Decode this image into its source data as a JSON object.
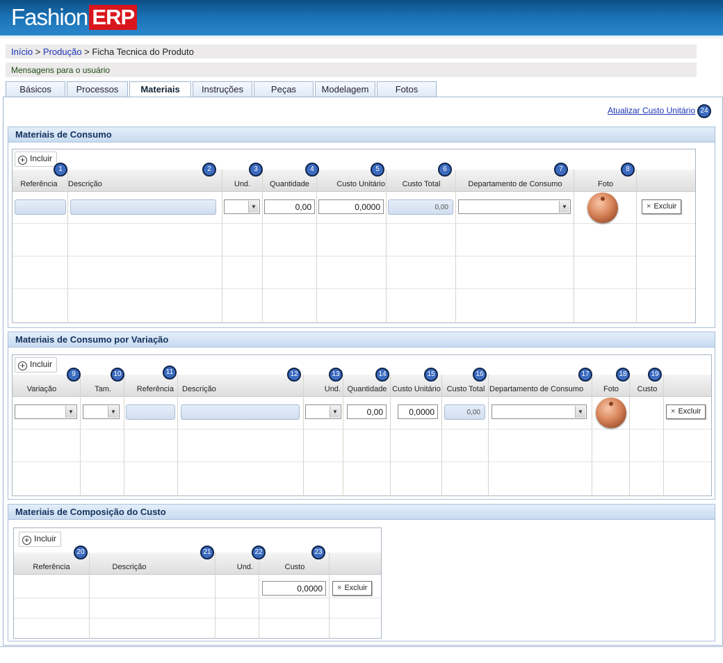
{
  "logo": {
    "part1": "Fashion",
    "part2": "ERP"
  },
  "breadcrumb": {
    "home": "Início",
    "sep1": ">",
    "area": "Produção",
    "sep2": ">",
    "page": "Ficha Tecnica do Produto"
  },
  "messages": "Mensagens para o usuário",
  "tabs": [
    "Básicos",
    "Processos",
    "Materiais",
    "Instruções",
    "Peças",
    "Modelagem",
    "Fotos"
  ],
  "active_tab": "Materiais",
  "update_link": "Atualizar Custo Unitário",
  "update_badge": "24",
  "include_label": "Incluir",
  "delete_label": "Excluir",
  "section1": {
    "title": "Materiais de Consumo",
    "columns": [
      "Referência",
      "Descrição",
      "Und.",
      "Quantidade",
      "Custo Unitário",
      "Custo Total",
      "Departamento de Consumo",
      "Foto"
    ],
    "badges": [
      "1",
      "2",
      "3",
      "4",
      "5",
      "6",
      "7",
      "8"
    ],
    "row": {
      "quantidade": "0,00",
      "custo_unitario": "0,0000",
      "custo_total": "0,00"
    }
  },
  "section2": {
    "title": "Materiais de Consumo por Variação",
    "columns": [
      "Variação",
      "Tam.",
      "Referência",
      "Descrição",
      "Und.",
      "Quantidade",
      "Custo Unitário",
      "Custo Total",
      "Departamento de Consumo",
      "Foto",
      "Custo"
    ],
    "badges": [
      "9",
      "10",
      "11",
      "12",
      "13",
      "14",
      "15",
      "16",
      "17",
      "18",
      "19"
    ],
    "row": {
      "quantidade": "0,00",
      "custo_unitario": "0,0000",
      "custo_total": "0,00"
    }
  },
  "section3": {
    "title": "Materiais de Composição do Custo",
    "columns": [
      "Referência",
      "Descrição",
      "Und.",
      "Custo"
    ],
    "badges": [
      "20",
      "21",
      "22",
      "23"
    ],
    "row": {
      "custo": "0,0000"
    }
  },
  "colors": {
    "header": "#1b73b6",
    "badge": "#3c6bc0",
    "section_title": "#13315d",
    "link": "#1a33b8"
  }
}
